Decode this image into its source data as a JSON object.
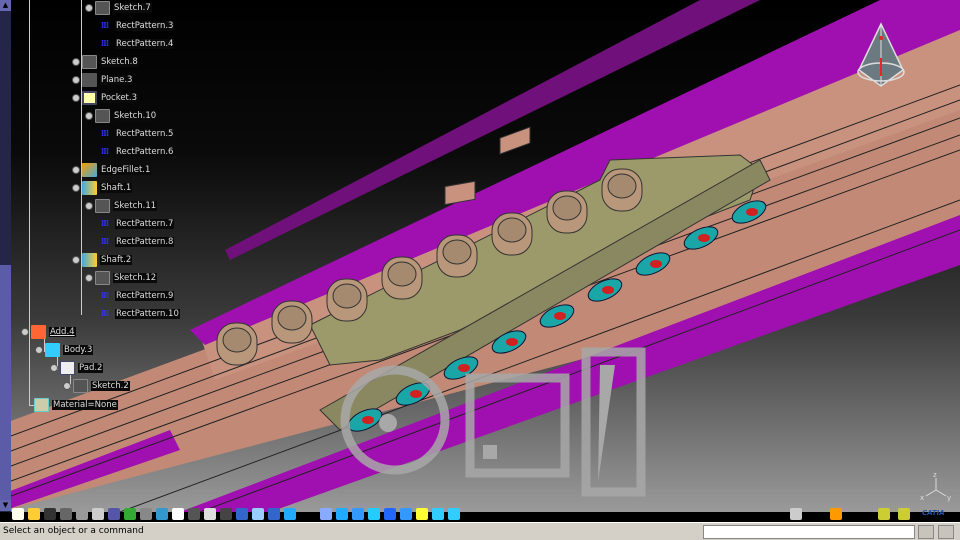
{
  "tree": {
    "items": [
      {
        "label": "Sketch.7",
        "icon": "sketch-icon"
      },
      {
        "label": "RectPattern.3",
        "icon": "rect-pattern-icon"
      },
      {
        "label": "RectPattern.4",
        "icon": "rect-pattern-icon"
      },
      {
        "label": "Sketch.8",
        "icon": "sketch-icon"
      },
      {
        "label": "Plane.3",
        "icon": "plane-icon"
      },
      {
        "label": "Pocket.3",
        "icon": "pocket-icon"
      },
      {
        "label": "Sketch.10",
        "icon": "sketch-icon"
      },
      {
        "label": "RectPattern.5",
        "icon": "rect-pattern-icon"
      },
      {
        "label": "RectPattern.6",
        "icon": "rect-pattern-icon"
      },
      {
        "label": "EdgeFillet.1",
        "icon": "edge-fillet-icon"
      },
      {
        "label": "Shaft.1",
        "icon": "shaft-icon"
      },
      {
        "label": "Sketch.11",
        "icon": "sketch-icon"
      },
      {
        "label": "RectPattern.7",
        "icon": "rect-pattern-icon"
      },
      {
        "label": "RectPattern.8",
        "icon": "rect-pattern-icon"
      },
      {
        "label": "Shaft.2",
        "icon": "shaft-icon"
      },
      {
        "label": "Sketch.12",
        "icon": "sketch-icon"
      },
      {
        "label": "RectPattern.9",
        "icon": "rect-pattern-icon"
      },
      {
        "label": "RectPattern.10",
        "icon": "rect-pattern-icon"
      },
      {
        "label": "Add.4",
        "icon": "add-icon"
      },
      {
        "label": "Body.3",
        "icon": "body-icon"
      },
      {
        "label": "Pad.2",
        "icon": "pad-icon"
      },
      {
        "label": "Sketch.2",
        "icon": "sketch-icon"
      },
      {
        "label": "Material=None",
        "icon": "material-icon"
      }
    ]
  },
  "axis": {
    "x": "x",
    "y": "y",
    "z": "z"
  },
  "status": {
    "text": "Select an object or a command",
    "command_value": ""
  },
  "brand": {
    "logo": "CATIA"
  },
  "colors": {
    "part_pink": "#c88f7a",
    "part_magenta": "#a010b0",
    "plate": "#9c9a6a",
    "roller": "#1aa6a6",
    "roller_core": "#d02020"
  }
}
